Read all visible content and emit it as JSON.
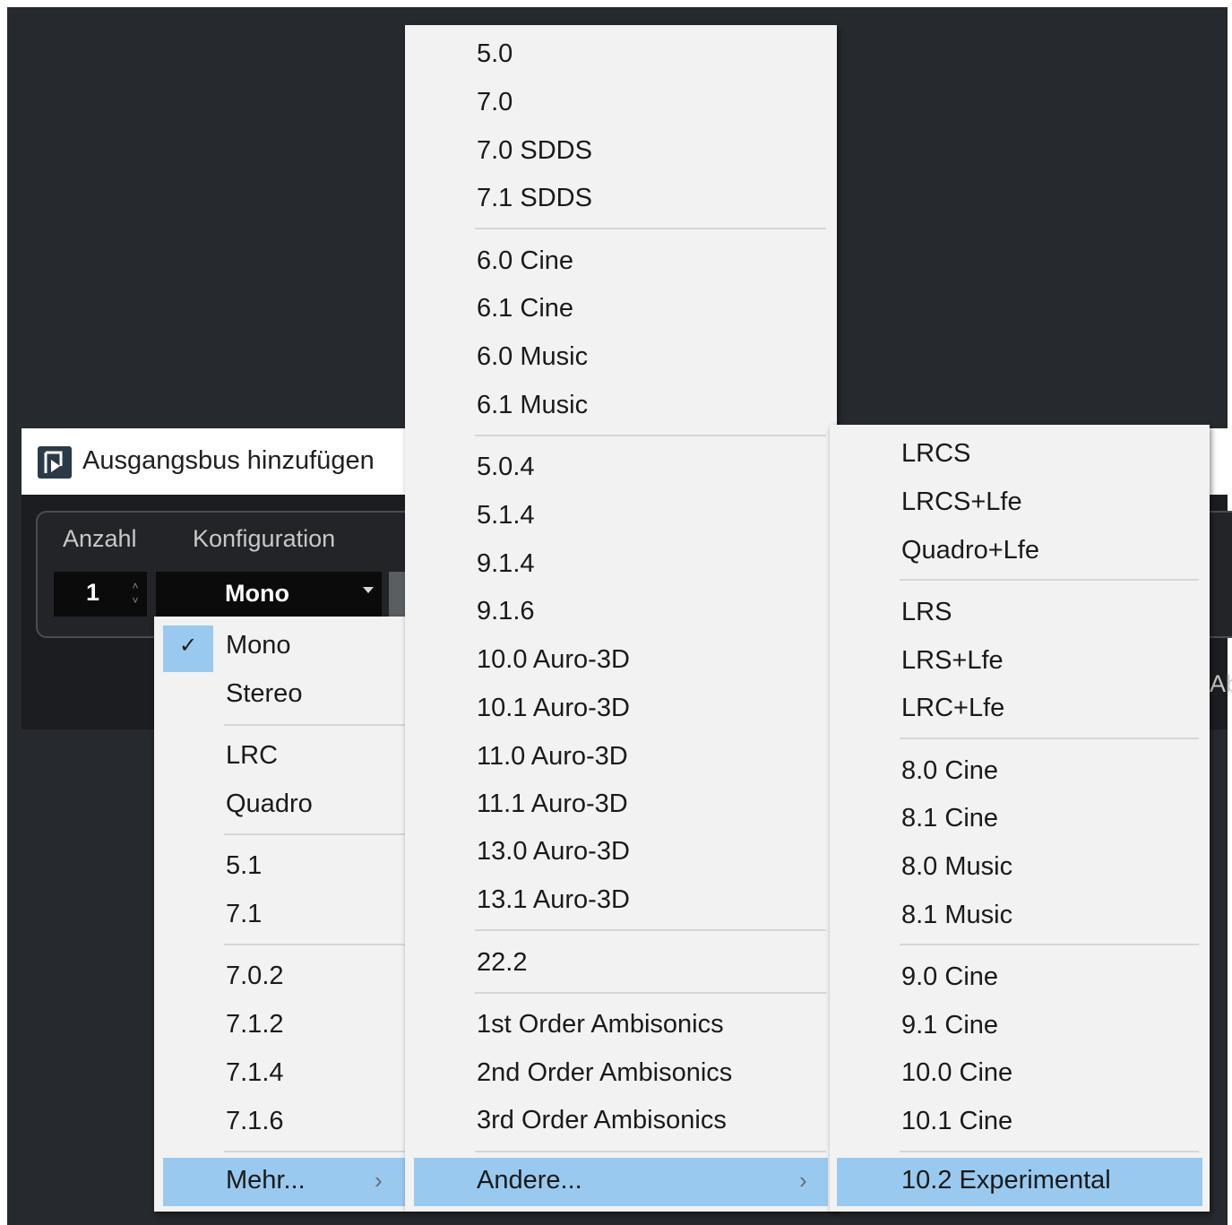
{
  "dialog": {
    "title": "Ausgangsbus hinzufügen",
    "labels": {
      "count": "Anzahl",
      "configuration": "Konfiguration"
    },
    "count_value": "1",
    "configuration_value": "Mono",
    "partial_button_text": "Ab"
  },
  "menu1": {
    "checked_item": "Mono",
    "items": [
      "Mono",
      "Stereo",
      "LRC",
      "Quadro",
      "5.1",
      "7.1",
      "7.0.2",
      "7.1.2",
      "7.1.4",
      "7.1.6",
      "Mehr..."
    ]
  },
  "menu2": {
    "items": [
      "5.0",
      "7.0",
      "7.0 SDDS",
      "7.1 SDDS",
      "6.0 Cine",
      "6.1 Cine",
      "6.0 Music",
      "6.1 Music",
      "5.0.4",
      "5.1.4",
      "9.1.4",
      "9.1.6",
      "10.0 Auro-3D",
      "10.1 Auro-3D",
      "11.0 Auro-3D",
      "11.1 Auro-3D",
      "13.0 Auro-3D",
      "13.1 Auro-3D",
      "22.2",
      "1st Order Ambisonics",
      "2nd Order Ambisonics",
      "3rd Order Ambisonics",
      "Andere..."
    ]
  },
  "menu3": {
    "items": [
      "LRCS",
      "LRCS+Lfe",
      "Quadro+Lfe",
      "LRS",
      "LRS+Lfe",
      "LRC+Lfe",
      "8.0 Cine",
      "8.1 Cine",
      "8.0 Music",
      "8.1 Music",
      "9.0 Cine",
      "9.1 Cine",
      "10.0 Cine",
      "10.1 Cine",
      "10.2 Experimental"
    ]
  },
  "colors": {
    "highlight": "#99c9ef",
    "menu_bg": "#f2f2f2",
    "background": "#26292d"
  },
  "icons": {
    "app": "app-logo-icon",
    "check": "check-icon",
    "submenu": "chevron-right-icon",
    "dropdown": "dropdown-arrow-icon"
  }
}
